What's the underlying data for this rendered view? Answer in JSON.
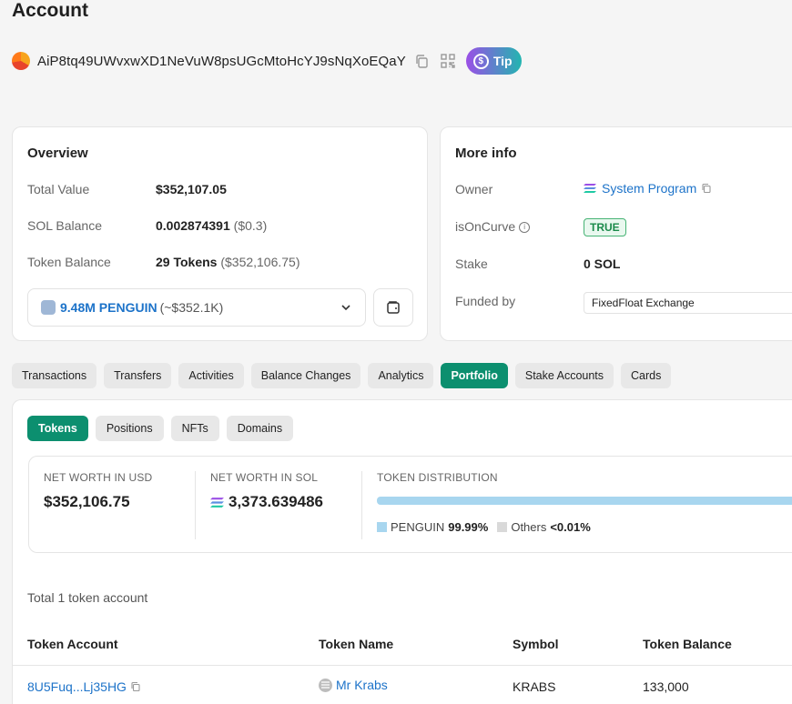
{
  "page": {
    "title": "Account"
  },
  "account": {
    "address": "AiP8tq49UWvxwXD1NeVuW8psUGcMtoHcYJ9sNqXoEQaY",
    "tip_label": "Tip",
    "tip_glyph": "$"
  },
  "overview": {
    "title": "Overview",
    "total_value_label": "Total Value",
    "total_value": "$352,107.05",
    "sol_balance_label": "SOL Balance",
    "sol_balance": "0.002874391",
    "sol_balance_usd": "($0.3)",
    "token_balance_label": "Token Balance",
    "token_balance": "29 Tokens",
    "token_balance_usd": "($352,106.75)",
    "selected_token_name": "9.48M PENGUIN",
    "selected_token_approx": "(~$352.1K)"
  },
  "more_info": {
    "title": "More info",
    "owner_label": "Owner",
    "owner_value": "System Program",
    "on_curve_label": "isOnCurve",
    "on_curve_value": "TRUE",
    "stake_label": "Stake",
    "stake_value": "0 SOL",
    "funded_label": "Funded by",
    "funded_value": "FixedFloat Exchange"
  },
  "tabs": [
    {
      "label": "Transactions"
    },
    {
      "label": "Transfers"
    },
    {
      "label": "Activities"
    },
    {
      "label": "Balance Changes"
    },
    {
      "label": "Analytics"
    },
    {
      "label": "Portfolio"
    },
    {
      "label": "Stake Accounts"
    },
    {
      "label": "Cards"
    }
  ],
  "portfolio": {
    "subtabs": [
      {
        "label": "Tokens"
      },
      {
        "label": "Positions"
      },
      {
        "label": "NFTs"
      },
      {
        "label": "Domains"
      }
    ],
    "net_worth_usd_label": "NET WORTH IN USD",
    "net_worth_usd": "$352,106.75",
    "net_worth_sol_label": "NET WORTH IN SOL",
    "net_worth_sol": "3,373.639486",
    "distribution_label": "TOKEN DISTRIBUTION",
    "distribution": [
      {
        "name": "PENGUIN",
        "pct_text": "99.99%",
        "color": "#a8d6ef",
        "fraction": 0.9999
      },
      {
        "name": "Others",
        "pct_text": "<0.01%",
        "color": "#d9d9d9",
        "fraction": 0.0001
      }
    ],
    "total_accounts": "Total 1 token account",
    "table": {
      "headers": {
        "account": "Token Account",
        "name": "Token Name",
        "symbol": "Symbol",
        "balance": "Token Balance"
      },
      "rows": [
        {
          "account": "8U5Fuq...Lj35HG",
          "name": "Mr Krabs",
          "symbol": "KRABS",
          "balance": "133,000"
        }
      ]
    }
  },
  "colors": {
    "accent": "#0c8f6f",
    "link": "#1d73c9"
  }
}
